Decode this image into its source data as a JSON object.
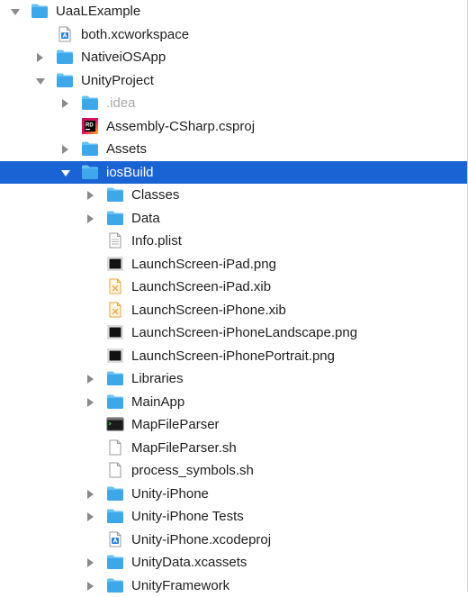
{
  "tree": [
    {
      "label": "UaaLExample",
      "icon": "folder",
      "depth": 0,
      "disclosure": "expanded"
    },
    {
      "label": "both.xcworkspace",
      "icon": "xcode-file",
      "depth": 1,
      "disclosure": "none"
    },
    {
      "label": "NativeiOSApp",
      "icon": "folder",
      "depth": 1,
      "disclosure": "collapsed"
    },
    {
      "label": "UnityProject",
      "icon": "folder",
      "depth": 1,
      "disclosure": "expanded"
    },
    {
      "label": ".idea",
      "icon": "folder",
      "depth": 2,
      "disclosure": "collapsed",
      "dim": true
    },
    {
      "label": "Assembly-CSharp.csproj",
      "icon": "rider-file",
      "depth": 2,
      "disclosure": "none"
    },
    {
      "label": "Assets",
      "icon": "folder",
      "depth": 2,
      "disclosure": "collapsed"
    },
    {
      "label": "iosBuild",
      "icon": "folder",
      "depth": 2,
      "disclosure": "expanded",
      "selected": true
    },
    {
      "label": "Classes",
      "icon": "folder",
      "depth": 3,
      "disclosure": "collapsed"
    },
    {
      "label": "Data",
      "icon": "folder",
      "depth": 3,
      "disclosure": "collapsed"
    },
    {
      "label": "Info.plist",
      "icon": "plist-file",
      "depth": 3,
      "disclosure": "none"
    },
    {
      "label": "LaunchScreen-iPad.png",
      "icon": "image-file",
      "depth": 3,
      "disclosure": "none"
    },
    {
      "label": "LaunchScreen-iPad.xib",
      "icon": "xib-file",
      "depth": 3,
      "disclosure": "none"
    },
    {
      "label": "LaunchScreen-iPhone.xib",
      "icon": "xib-file",
      "depth": 3,
      "disclosure": "none"
    },
    {
      "label": "LaunchScreen-iPhoneLandscape.png",
      "icon": "image-file",
      "depth": 3,
      "disclosure": "none"
    },
    {
      "label": "LaunchScreen-iPhonePortrait.png",
      "icon": "image-file",
      "depth": 3,
      "disclosure": "none"
    },
    {
      "label": "Libraries",
      "icon": "folder",
      "depth": 3,
      "disclosure": "collapsed"
    },
    {
      "label": "MainApp",
      "icon": "folder",
      "depth": 3,
      "disclosure": "collapsed"
    },
    {
      "label": "MapFileParser",
      "icon": "terminal-file",
      "depth": 3,
      "disclosure": "none"
    },
    {
      "label": "MapFileParser.sh",
      "icon": "blank-file",
      "depth": 3,
      "disclosure": "none"
    },
    {
      "label": "process_symbols.sh",
      "icon": "blank-file",
      "depth": 3,
      "disclosure": "none"
    },
    {
      "label": "Unity-iPhone",
      "icon": "folder",
      "depth": 3,
      "disclosure": "collapsed"
    },
    {
      "label": "Unity-iPhone Tests",
      "icon": "folder",
      "depth": 3,
      "disclosure": "collapsed"
    },
    {
      "label": "Unity-iPhone.xcodeproj",
      "icon": "xcode-file",
      "depth": 3,
      "disclosure": "none"
    },
    {
      "label": "UnityData.xcassets",
      "icon": "folder",
      "depth": 3,
      "disclosure": "collapsed"
    },
    {
      "label": "UnityFramework",
      "icon": "folder",
      "depth": 3,
      "disclosure": "collapsed"
    }
  ],
  "colors": {
    "selection": "#1a63d4",
    "folder": "#3ea7ea",
    "folder_tab": "#68c1f4",
    "disclosure": "#8a8a8a",
    "dim_text": "#a9a9a9"
  }
}
